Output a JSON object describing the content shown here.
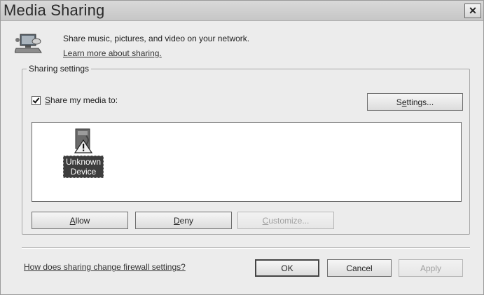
{
  "window": {
    "title": "Media Sharing",
    "close_glyph": "✕"
  },
  "header": {
    "description": "Share music, pictures, and video on your network.",
    "learn_more_link": "Learn more about sharing."
  },
  "sharing_settings": {
    "group_label": "Sharing settings",
    "share_checkbox": {
      "label_access_key": "S",
      "label_rest": "hare my media to:",
      "checked": true
    },
    "settings_button": {
      "pre": "S",
      "access_key": "e",
      "post": "ttings..."
    },
    "devices": [
      {
        "label_line1": "Unknown",
        "label_line2": "Device",
        "icon": "unknown-device-warning-icon"
      }
    ],
    "allow_button": {
      "access_key": "A",
      "rest": "llow"
    },
    "deny_button": {
      "access_key": "D",
      "rest": "eny"
    },
    "customize_button": {
      "access_key": "C",
      "rest": "ustomize...",
      "enabled": false
    }
  },
  "footer": {
    "firewall_link": "How does sharing change firewall settings?",
    "ok_label": "OK",
    "cancel_label": "Cancel",
    "apply_label": "Apply",
    "apply_enabled": false
  }
}
